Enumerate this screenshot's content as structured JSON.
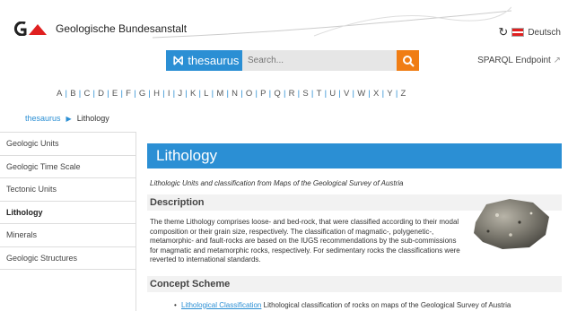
{
  "header": {
    "org_name": "Geologische Bundesanstalt",
    "language_label": "Deutsch",
    "brand_label": "thesaurus",
    "search_placeholder": "Search...",
    "sparql_label": "SPARQL Endpoint"
  },
  "alphabet": [
    "A",
    "B",
    "C",
    "D",
    "E",
    "F",
    "G",
    "H",
    "I",
    "J",
    "K",
    "L",
    "M",
    "N",
    "O",
    "P",
    "Q",
    "R",
    "S",
    "T",
    "U",
    "V",
    "W",
    "X",
    "Y",
    "Z"
  ],
  "breadcrumb": {
    "root": "thesaurus",
    "current": "Lithology"
  },
  "sidebar": {
    "items": [
      {
        "label": "Geologic Units",
        "active": false
      },
      {
        "label": "Geologic Time Scale",
        "active": false
      },
      {
        "label": "Tectonic Units",
        "active": false
      },
      {
        "label": "Lithology",
        "active": true
      },
      {
        "label": "Minerals",
        "active": false
      },
      {
        "label": "Geologic Structures",
        "active": false
      }
    ]
  },
  "main": {
    "title": "Lithology",
    "subtitle": "Lithologic Units and classification from Maps of the Geological Survey of Austria",
    "description_heading": "Description",
    "description_text": "The theme Lithology comprises loose- and bed-rock, that were classified according to their modal composition or their grain size, respectively. The classification of magmatic-, polygenetic-, metamorphic- and fault-rocks are based on the IUGS recommendations by the sub-commissions for magmatic and metamorphic rocks, respectively. For sedimentary rocks the classifications were reverted to international standards.",
    "concept_heading": "Concept Scheme",
    "concept_link": "Lithological Classification",
    "concept_text": "Lithological classification of rocks on maps of the Geological Survey of Austria"
  },
  "colors": {
    "accent": "#2b8fd4",
    "search_button": "#f07d14",
    "logo_red": "#e02020"
  }
}
